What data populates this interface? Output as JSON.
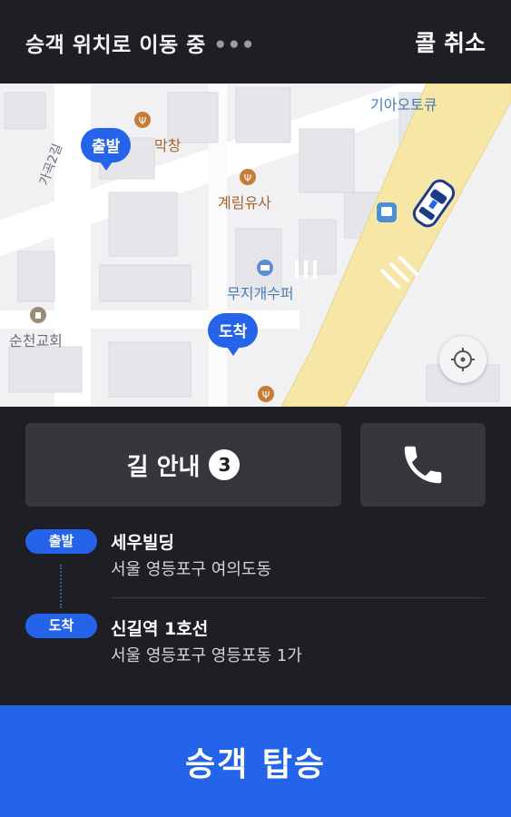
{
  "header": {
    "status_text": "승객 위치로 이동 중",
    "status_dots": "•••",
    "cancel_label": "콜 취소"
  },
  "map": {
    "labels": {
      "kia_autoq": "기아오토큐",
      "restaurant_top": "막창",
      "gyerim": "계림유사",
      "street": "가곡2길",
      "mujigae": "무지개수퍼",
      "church": "순천교회"
    },
    "pins": {
      "departure": "출발",
      "arrival": "도착"
    }
  },
  "actions": {
    "nav_label": "길 안내",
    "nav_badge": "3"
  },
  "route": {
    "departure": {
      "tag": "출발",
      "name": "세우빌딩",
      "address": "서울 영등포구 여의도동"
    },
    "arrival": {
      "tag": "도착",
      "name": "신길역 1호선",
      "address": "서울 영등포구 영등포동 1가"
    }
  },
  "footer": {
    "board_label": "승객 탑승"
  },
  "colors": {
    "accent": "#2563eb",
    "background": "#1e1f24",
    "button": "#35373d",
    "road_main": "#f6e7a6"
  }
}
